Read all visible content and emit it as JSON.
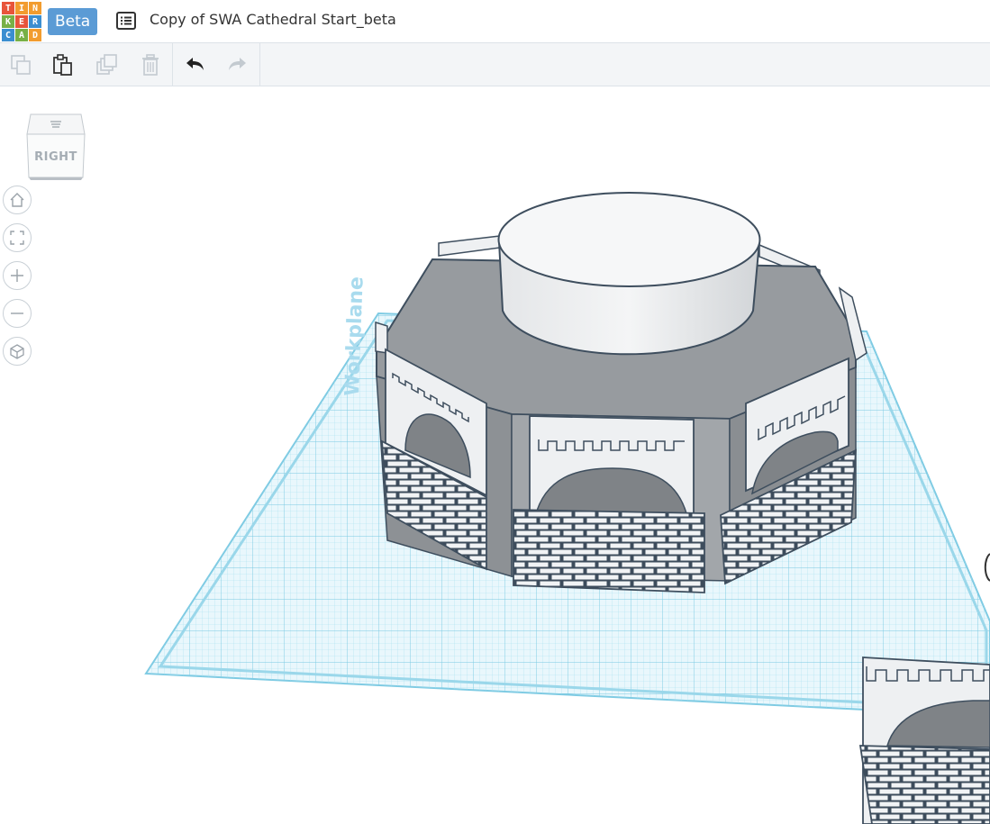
{
  "app": {
    "logo_letters": [
      "T",
      "I",
      "N",
      "K",
      "E",
      "R",
      "C",
      "A",
      "D"
    ],
    "logo_colors": [
      "#e8543b",
      "#f29c2f",
      "#f29c2f",
      "#78b046",
      "#e8543b",
      "#3b8ed0",
      "#3b8ed0",
      "#78b046",
      "#f29c2f"
    ],
    "beta_label": "Beta",
    "design_title": "Copy of SWA Cathedral Start_beta"
  },
  "toolbar": {
    "buttons": [
      {
        "name": "copy-button",
        "icon": "copy-icon",
        "enabled": false
      },
      {
        "name": "paste-button",
        "icon": "paste-icon",
        "enabled": true
      },
      {
        "name": "duplicate-button",
        "icon": "duplicate-icon",
        "enabled": false
      },
      {
        "name": "delete-button",
        "icon": "trash-icon",
        "enabled": false
      },
      {
        "name": "undo-button",
        "icon": "undo-icon",
        "enabled": true
      },
      {
        "name": "redo-button",
        "icon": "redo-icon",
        "enabled": false
      }
    ]
  },
  "viewcube": {
    "face_label": "RIGHT"
  },
  "nav": {
    "buttons": [
      "home-view-icon",
      "fit-all-icon",
      "zoom-in-icon",
      "zoom-out-icon",
      "perspective-icon"
    ]
  },
  "workplane": {
    "label": "Workplane"
  },
  "colors": {
    "accent": "#5b9bd5",
    "grid": "#8fd3ea",
    "model": "#a3a7ab",
    "brick": "#eef0f2"
  }
}
